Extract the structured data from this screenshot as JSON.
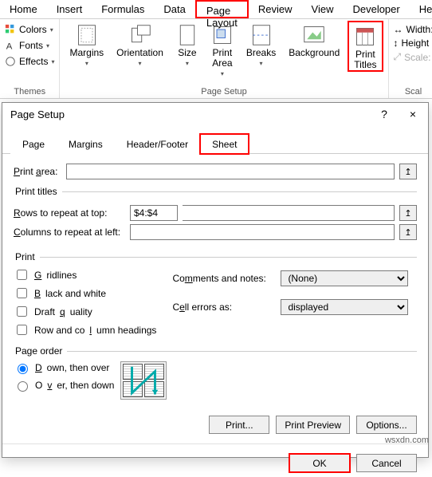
{
  "ribbon": {
    "tabs": [
      "Home",
      "Insert",
      "Formulas",
      "Data",
      "Page Layout",
      "Review",
      "View",
      "Developer",
      "Hel"
    ],
    "active_tab": "Page Layout",
    "themes": {
      "colors": "Colors",
      "fonts": "Fonts",
      "effects": "Effects",
      "group_label": "Themes"
    },
    "page_setup": {
      "margins": "Margins",
      "orientation": "Orientation",
      "size": "Size",
      "print_area": "Print\nArea",
      "breaks": "Breaks",
      "background": "Background",
      "print_titles": "Print\nTitles",
      "group_label": "Page Setup"
    },
    "scale": {
      "width": "Width:",
      "height": "Height",
      "scale": "Scale:",
      "group_label": "Scal"
    }
  },
  "dialog": {
    "title": "Page Setup",
    "help": "?",
    "close": "×",
    "tabs": {
      "page": "Page",
      "margins": "Margins",
      "headerfooter": "Header/Footer",
      "sheet": "Sheet"
    },
    "print_area_label": "Print area:",
    "print_area_value": "",
    "print_titles_legend": "Print titles",
    "rows_label": "Rows to repeat at top:",
    "rows_value": "$4:$4",
    "cols_label": "Columns to repeat at left:",
    "cols_value": "",
    "print_legend": "Print",
    "checks": {
      "gridlines": "Gridlines",
      "bw": "Black and white",
      "draft": "Draft quality",
      "rowcol": "Row and column headings"
    },
    "comments_label": "Comments and notes:",
    "comments_value": "(None)",
    "cellerrors_label": "Cell errors as:",
    "cellerrors_value": "displayed",
    "pageorder_legend": "Page order",
    "radios": {
      "down": "Down, then over",
      "over": "Over, then down"
    },
    "buttons": {
      "print": "Print...",
      "preview": "Print Preview",
      "options": "Options...",
      "ok": "OK",
      "cancel": "Cancel"
    }
  },
  "watermark": "wsxdn.com"
}
